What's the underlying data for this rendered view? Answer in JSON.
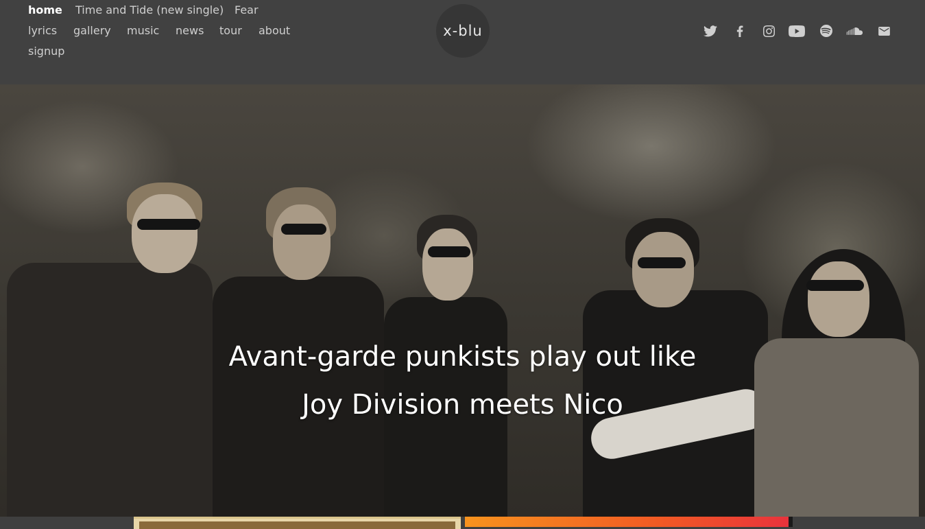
{
  "nav": {
    "row1": [
      "home",
      "Time and Tide (new single)",
      "Fear"
    ],
    "row2": [
      "lyrics",
      "gallery",
      "music",
      "news",
      "tour",
      "about"
    ],
    "row3": [
      "signup"
    ],
    "active": "home"
  },
  "logo": {
    "text": "x-blu"
  },
  "social": [
    "twitter-icon",
    "facebook-icon",
    "instagram-icon",
    "youtube-icon",
    "spotify-icon",
    "soundcloud-icon",
    "email-icon"
  ],
  "hero": {
    "line1": "Avant-garde punkists play out like",
    "line2": "Joy Division meets Nico"
  },
  "colors": {
    "header_bg": "#414141",
    "nav_text": "#cfcfcf",
    "active_text": "#ffffff"
  }
}
